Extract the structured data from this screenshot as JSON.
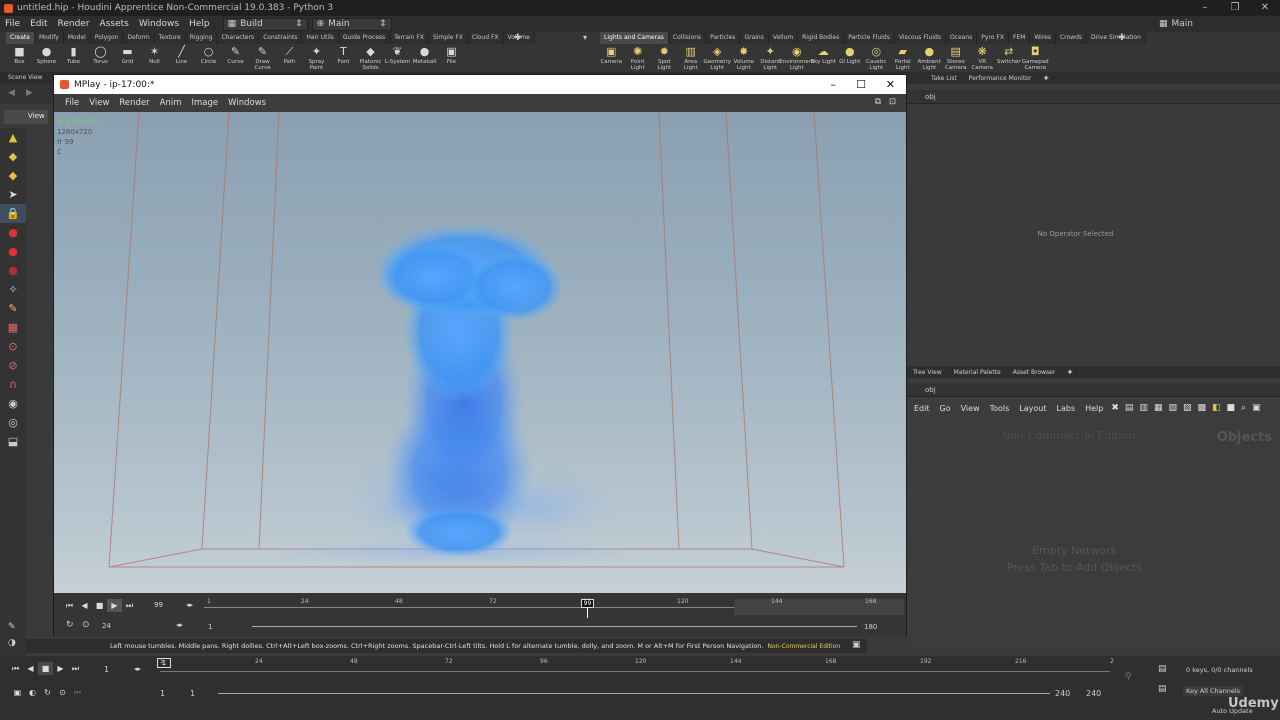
{
  "app": {
    "title": "untitled.hip - Houdini Apprentice Non-Commercial 19.0.383 - Python 3"
  },
  "menu": [
    "File",
    "Edit",
    "Render",
    "Assets",
    "Windows",
    "Help"
  ],
  "desktop": {
    "build": "Build",
    "main": "Main",
    "right_main": "Main"
  },
  "shelf_left": {
    "tabs": [
      "Create",
      "Modify",
      "Model",
      "Polygon",
      "Deform",
      "Texture",
      "Rigging",
      "Characters",
      "Constraints",
      "Hair Utils",
      "Guide Process",
      "Terrain FX",
      "Simple FX",
      "Cloud FX",
      "Volume"
    ],
    "tools": [
      {
        "icon": "box-icon",
        "glyph": "■",
        "label": "Box"
      },
      {
        "icon": "sphere-icon",
        "glyph": "●",
        "label": "Sphere"
      },
      {
        "icon": "tube-icon",
        "glyph": "▮",
        "label": "Tube"
      },
      {
        "icon": "torus-icon",
        "glyph": "◯",
        "label": "Torus"
      },
      {
        "icon": "grid-icon",
        "glyph": "▬",
        "label": "Grid"
      },
      {
        "icon": "null-icon",
        "glyph": "✶",
        "label": "Null"
      },
      {
        "icon": "line-icon",
        "glyph": "╱",
        "label": "Line"
      },
      {
        "icon": "circle-icon",
        "glyph": "○",
        "label": "Circle"
      },
      {
        "icon": "curve-icon",
        "glyph": "✎",
        "label": "Curve"
      },
      {
        "icon": "draw-curve-icon",
        "glyph": "✎",
        "label": "Draw Curve"
      },
      {
        "icon": "path-icon",
        "glyph": "⟋",
        "label": "Path"
      },
      {
        "icon": "spray-paint-icon",
        "glyph": "✦",
        "label": "Spray Paint"
      },
      {
        "icon": "font-icon",
        "glyph": "T",
        "label": "Font"
      },
      {
        "icon": "platonic-icon",
        "glyph": "◆",
        "label": "Platonic Solids"
      },
      {
        "icon": "lsystem-icon",
        "glyph": "❦",
        "label": "L-System"
      },
      {
        "icon": "metaball-icon",
        "glyph": "●",
        "label": "Metaball"
      },
      {
        "icon": "file-icon",
        "glyph": "▣",
        "label": "File"
      }
    ]
  },
  "shelf_right": {
    "tabs": [
      "Lights and Cameras",
      "Collisions",
      "Particles",
      "Grains",
      "Vellum",
      "Rigid Bodies",
      "Particle Fluids",
      "Viscous Fluids",
      "Oceans",
      "Pyro FX",
      "FEM",
      "Wires",
      "Crowds",
      "Drive Simulation"
    ],
    "tools": [
      {
        "icon": "camera-icon",
        "glyph": "▣",
        "label": "Camera"
      },
      {
        "icon": "point-light-icon",
        "glyph": "✺",
        "label": "Point Light"
      },
      {
        "icon": "spot-light-icon",
        "glyph": "✹",
        "label": "Spot Light"
      },
      {
        "icon": "area-light-icon",
        "glyph": "▥",
        "label": "Area Light"
      },
      {
        "icon": "geometry-light-icon",
        "glyph": "◈",
        "label": "Geometry Light"
      },
      {
        "icon": "volume-light-icon",
        "glyph": "✸",
        "label": "Volume Light"
      },
      {
        "icon": "distant-light-icon",
        "glyph": "✦",
        "label": "Distant Light"
      },
      {
        "icon": "environment-light-icon",
        "glyph": "◉",
        "label": "Environment Light"
      },
      {
        "icon": "sky-light-icon",
        "glyph": "☁",
        "label": "Sky Light"
      },
      {
        "icon": "gi-light-icon",
        "glyph": "●",
        "label": "GI Light"
      },
      {
        "icon": "caustic-light-icon",
        "glyph": "◎",
        "label": "Caustic Light"
      },
      {
        "icon": "portal-light-icon",
        "glyph": "▰",
        "label": "Portal Light"
      },
      {
        "icon": "ambient-light-icon",
        "glyph": "●",
        "label": "Ambient Light"
      },
      {
        "icon": "stereo-camera-icon",
        "glyph": "▤",
        "label": "Stereo Camera"
      },
      {
        "icon": "vr-camera-icon",
        "glyph": "❋",
        "label": "VR Camera"
      },
      {
        "icon": "switcher-icon",
        "glyph": "⇄",
        "label": "Switcher"
      },
      {
        "icon": "gamepad-camera-icon",
        "glyph": "◘",
        "label": "Gamepad Camera"
      }
    ]
  },
  "scene_view_tab": "Scene View",
  "view_label": "View",
  "mplay": {
    "title": "MPlay - ip-17:00:*",
    "menu": [
      "File",
      "View",
      "Render",
      "Anim",
      "Image",
      "Windows"
    ],
    "info": [
      "ip-17:01:43",
      "1280x720",
      "fr 99",
      "C"
    ],
    "frame": "99",
    "fps": "24",
    "range_start": "1",
    "range_end": "180",
    "ruler": [
      "1",
      "24",
      "48",
      "72",
      "96",
      "120",
      "144",
      "168"
    ]
  },
  "right_top": {
    "tabs": [
      "Take List",
      "Performance Monitor"
    ],
    "path": "obj",
    "message": "No Operator Selected"
  },
  "network": {
    "tabs": [
      "Tree View",
      "Material Palette",
      "Asset Browser"
    ],
    "path": "obj",
    "menu": [
      "Edit",
      "Go",
      "View",
      "Tools",
      "Layout",
      "Labs",
      "Help"
    ],
    "watermark": "Non-Commercial Edition",
    "context": "Objects",
    "empty1": "Empty Network",
    "empty2": "Press Tab to Add Objects"
  },
  "status": {
    "text": "Left mouse tumbles. Middle pans. Right dollies. Ctrl+Alt+Left box-zooms. Ctrl+Right zooms. Spacebar-Ctrl-Left tilts. Hold L for alternate tumble, dolly, and zoom.     M or Alt+M for First Person Navigation.",
    "badge": "Non-Commercial Edition"
  },
  "timeline": {
    "frame": "1",
    "ruler": [
      "1",
      "24",
      "48",
      "72",
      "96",
      "120",
      "144",
      "168",
      "192",
      "216",
      "2"
    ],
    "start": "1",
    "start2": "1",
    "end": "240",
    "end2": "240",
    "keys": "0 keys, 0/0 channels",
    "key_all": "Key All Channels",
    "auto_update": "Auto Update"
  },
  "udemy": "Udemy",
  "colors": {
    "accent": "#f0a030",
    "shelf": "#353535",
    "viewport_top": "#8aa0b1"
  }
}
